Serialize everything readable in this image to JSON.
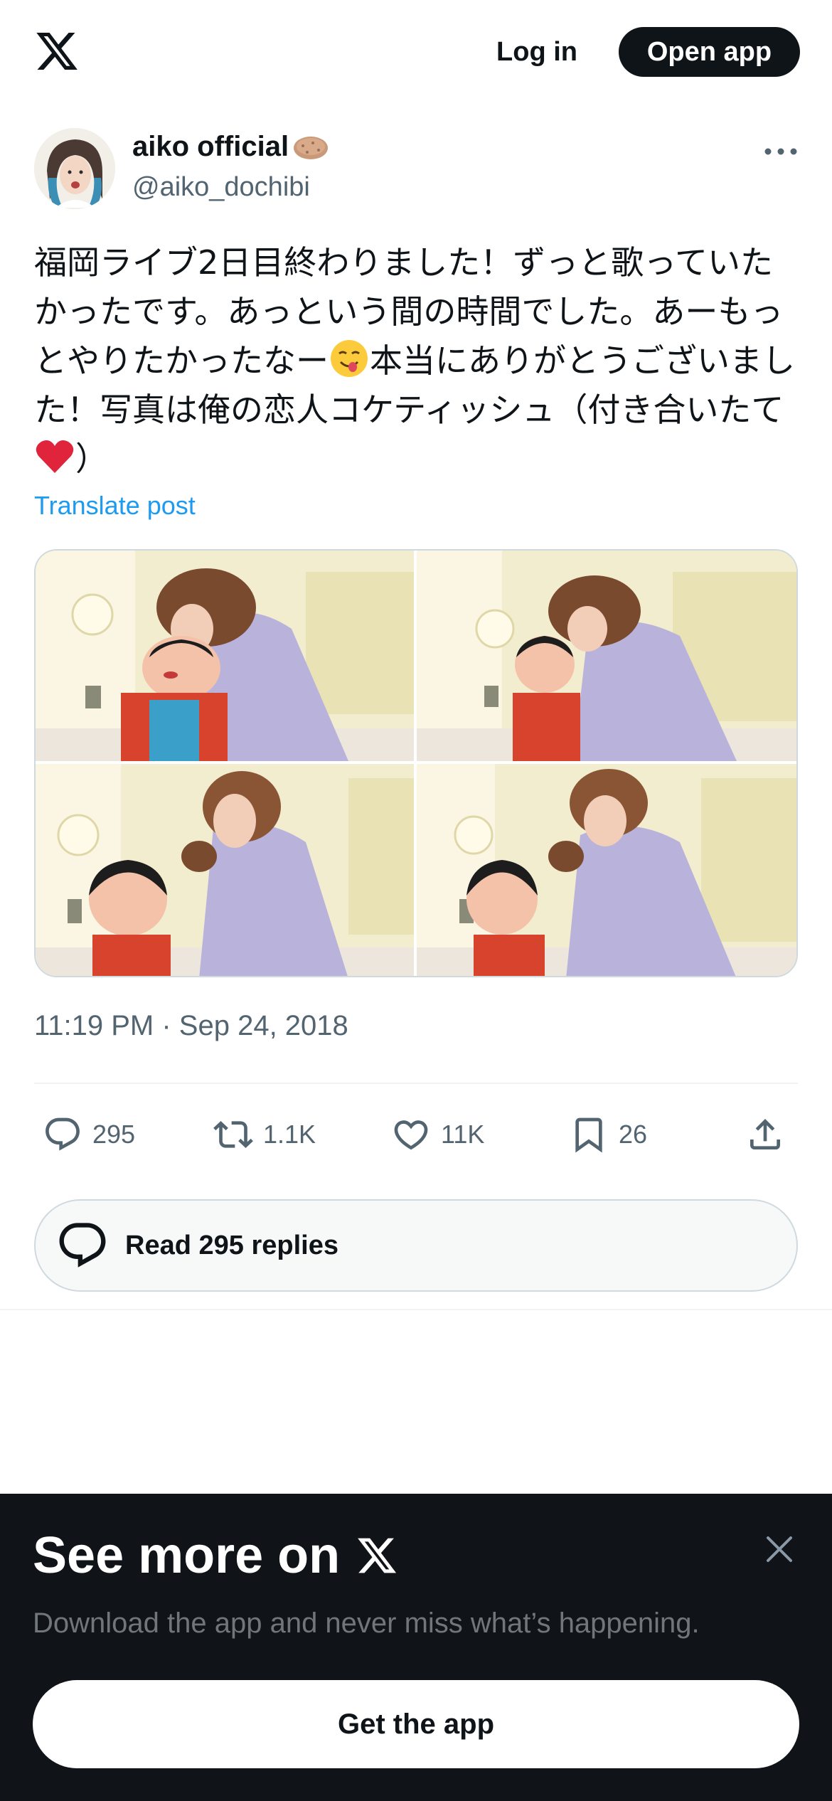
{
  "header": {
    "logo_icon": "x-logo-icon",
    "login_label": "Log in",
    "open_app_label": "Open app"
  },
  "post": {
    "author": {
      "display_name": "aiko official",
      "name_emoji": "potato-icon",
      "handle": "@aiko_dochibi"
    },
    "text": {
      "part1": "福岡ライブ2日目終わりました！ずっと歌っていたかったです。あっという間の時間でした。あーもっとやりたかったなー",
      "emoji1": "savoring-face-emoji",
      "part2": "本当にありがとうございました！写真は俺の恋人コケティッシュ（付き合いたて",
      "emoji2": "red-heart-emoji",
      "part3": "）"
    },
    "translate_label": "Translate post",
    "timestamp": "11:19 PM · Sep 24, 2018",
    "stats": {
      "replies": "295",
      "reposts": "1.1K",
      "likes": "11K",
      "bookmarks": "26"
    },
    "read_replies_label": "Read 295 replies"
  },
  "sheet": {
    "title": "See more on",
    "subtitle": "Download the app and never miss what’s happening.",
    "cta_label": "Get the app"
  },
  "colors": {
    "text_primary": "#0f1419",
    "text_secondary": "#536471",
    "link": "#1d9bf0",
    "sheet_bg": "#101419"
  }
}
